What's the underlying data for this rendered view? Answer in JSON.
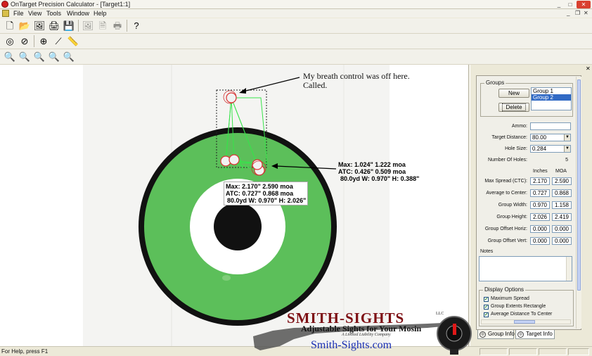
{
  "window": {
    "title": "OnTarget Precision Calculator - [Target1:1]",
    "controls": {
      "minimize": "_",
      "maximize": "□",
      "close": "✕"
    }
  },
  "menu": {
    "items": [
      "File",
      "View",
      "Tools",
      "Window",
      "Help"
    ],
    "mdi_controls": {
      "minimize": "_",
      "restore": "❐",
      "close": "✕"
    }
  },
  "toolbars": {
    "row1": [
      {
        "name": "new-icon",
        "glyph": "🗋"
      },
      {
        "name": "open-icon",
        "glyph": "📂"
      },
      {
        "name": "open-image-icon",
        "glyph": "🖼"
      },
      {
        "name": "scan-icon",
        "glyph": "🖨"
      },
      {
        "name": "save-icon",
        "glyph": "💾"
      },
      {
        "name": "export-image-icon",
        "glyph": "🖼",
        "disabled": true
      },
      {
        "name": "print-preview-icon",
        "glyph": "🗎",
        "disabled": true
      },
      {
        "name": "print-icon",
        "glyph": "🖶",
        "disabled": true
      },
      {
        "name": "help-icon",
        "glyph": "?"
      }
    ],
    "row2": [
      {
        "name": "measure-tool-icon",
        "glyph": "◎"
      },
      {
        "name": "rotate-tool-icon",
        "glyph": "⊘"
      },
      {
        "name": "crosshair-icon",
        "glyph": "⊕"
      },
      {
        "name": "line-tool-icon",
        "glyph": "⟋"
      },
      {
        "name": "ruler-icon",
        "glyph": "📏"
      }
    ],
    "row3": [
      {
        "name": "zoom-window-icon",
        "glyph": "🔍"
      },
      {
        "name": "zoom-in-icon",
        "glyph": "🔍"
      },
      {
        "name": "zoom-out-icon",
        "glyph": "🔍"
      },
      {
        "name": "zoom-fit-icon",
        "glyph": "🔍"
      },
      {
        "name": "zoom-actual-icon",
        "glyph": "🔍"
      }
    ]
  },
  "target": {
    "annotation": "My breath control was off here.\nCalled.",
    "group1_label": {
      "line1": "Max: 1.024\" 1.222 moa",
      "line2": "ATC: 0.426\" 0.509 moa",
      "line3": "80.0yd   W: 0.970\" H: 0.388\""
    },
    "group2_label": {
      "line1": "Max: 2.170\" 2.590 moa",
      "line2": "ATC: 0.727\" 0.868 moa",
      "line3": "80.0yd   W: 0.970\" H: 2.026\""
    },
    "colors": {
      "ring": "#5cbf5a",
      "black": "#111111",
      "group_lines": "#37e34a"
    }
  },
  "panel": {
    "groups_title": "Groups",
    "new_button": "New",
    "delete_button": "Delete",
    "group_list": [
      "Group 1",
      "Group 2"
    ],
    "selected_group": 1,
    "ammo_label": "Ammo:",
    "ammo_value": "",
    "target_distance_label": "Target Distance:",
    "target_distance_value": "80.00",
    "hole_size_label": "Hole Size:",
    "hole_size_value": "0.284",
    "num_holes_label": "Number Of Holes:",
    "num_holes_value": "5",
    "col_inches": "Inches",
    "col_moa": "MOA",
    "stats": [
      {
        "label": "Max Spread (CTC):",
        "inches": "2.170",
        "moa": "2.590"
      },
      {
        "label": "Average to Center:",
        "inches": "0.727",
        "moa": "0.868"
      },
      {
        "label": "Group Width:",
        "inches": "0.970",
        "moa": "1.158"
      },
      {
        "label": "Group Height:",
        "inches": "2.026",
        "moa": "2.419"
      },
      {
        "label": "Group Offset Horiz:",
        "inches": "0.000",
        "moa": "0.000"
      },
      {
        "label": "Group Offset Vert:",
        "inches": "0.000",
        "moa": "0.000"
      }
    ],
    "notes_label": "Notes",
    "notes_value": "",
    "display_options_title": "Display Options",
    "display_options": [
      {
        "label": "Maximum Spread",
        "checked": true
      },
      {
        "label": "Group Extents Rectangle",
        "checked": true
      },
      {
        "label": "Average Distance To Center",
        "checked": true
      }
    ],
    "tabs": [
      "Group Info",
      "Target Info"
    ],
    "active_tab": 1,
    "close_glyph": "✕"
  },
  "status": {
    "text": "For Help, press F1"
  },
  "logo": {
    "name": "SMITH-SIGHTS",
    "llc": "LLC",
    "tagline": "Adjustable Sights for Your Mosin",
    "subtitle": "A Limited Liability Company",
    "url": "Smith-Sights.com"
  }
}
